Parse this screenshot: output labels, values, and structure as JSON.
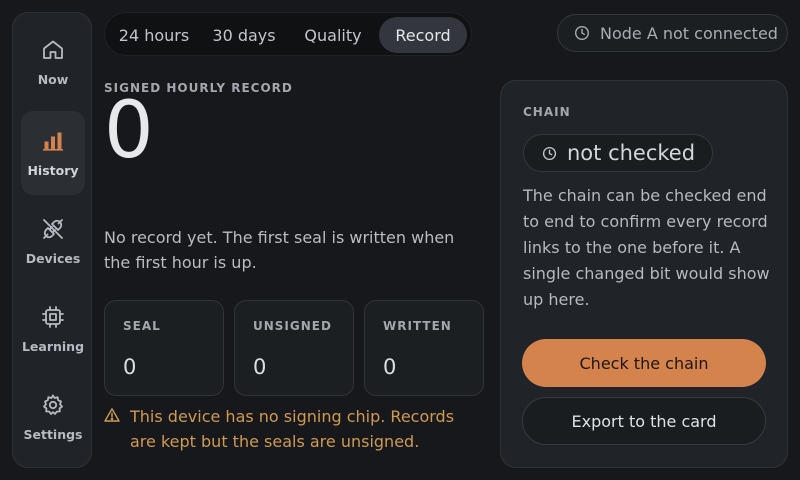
{
  "sidebar": {
    "items": [
      {
        "label": "Now",
        "icon": "home-icon"
      },
      {
        "label": "History",
        "icon": "bar-chart-icon"
      },
      {
        "label": "Devices",
        "icon": "plug-disconnected-icon"
      },
      {
        "label": "Learning",
        "icon": "chip-icon"
      },
      {
        "label": "Settings",
        "icon": "gear-icon"
      }
    ],
    "active": "History"
  },
  "tabs": {
    "items": [
      "24 hours",
      "30 days",
      "Quality",
      "Record"
    ],
    "active": "Record"
  },
  "node_status": {
    "icon": "clock-icon",
    "text": "Node A not connected"
  },
  "record": {
    "label": "SIGNED HOURLY RECORD",
    "count": "0",
    "empty_message": "No record yet. The first seal is written when the first hour is up.",
    "stats": [
      {
        "key": "SEAL",
        "value": "0"
      },
      {
        "key": "UNSIGNED",
        "value": "0"
      },
      {
        "key": "WRITTEN",
        "value": "0"
      }
    ],
    "warning": "This device has no signing chip. Records are kept but the seals are unsigned."
  },
  "chain": {
    "title": "CHAIN",
    "status": "not checked",
    "description": "The chain can be checked end to end to confirm every record links to the one before it. A single changed bit would show up here.",
    "check_button": "Check the chain",
    "export_button": "Export to the card"
  },
  "colors": {
    "accent": "#d5834d",
    "warning": "#cf9a52",
    "background": "#16181b",
    "panel": "#202327"
  }
}
